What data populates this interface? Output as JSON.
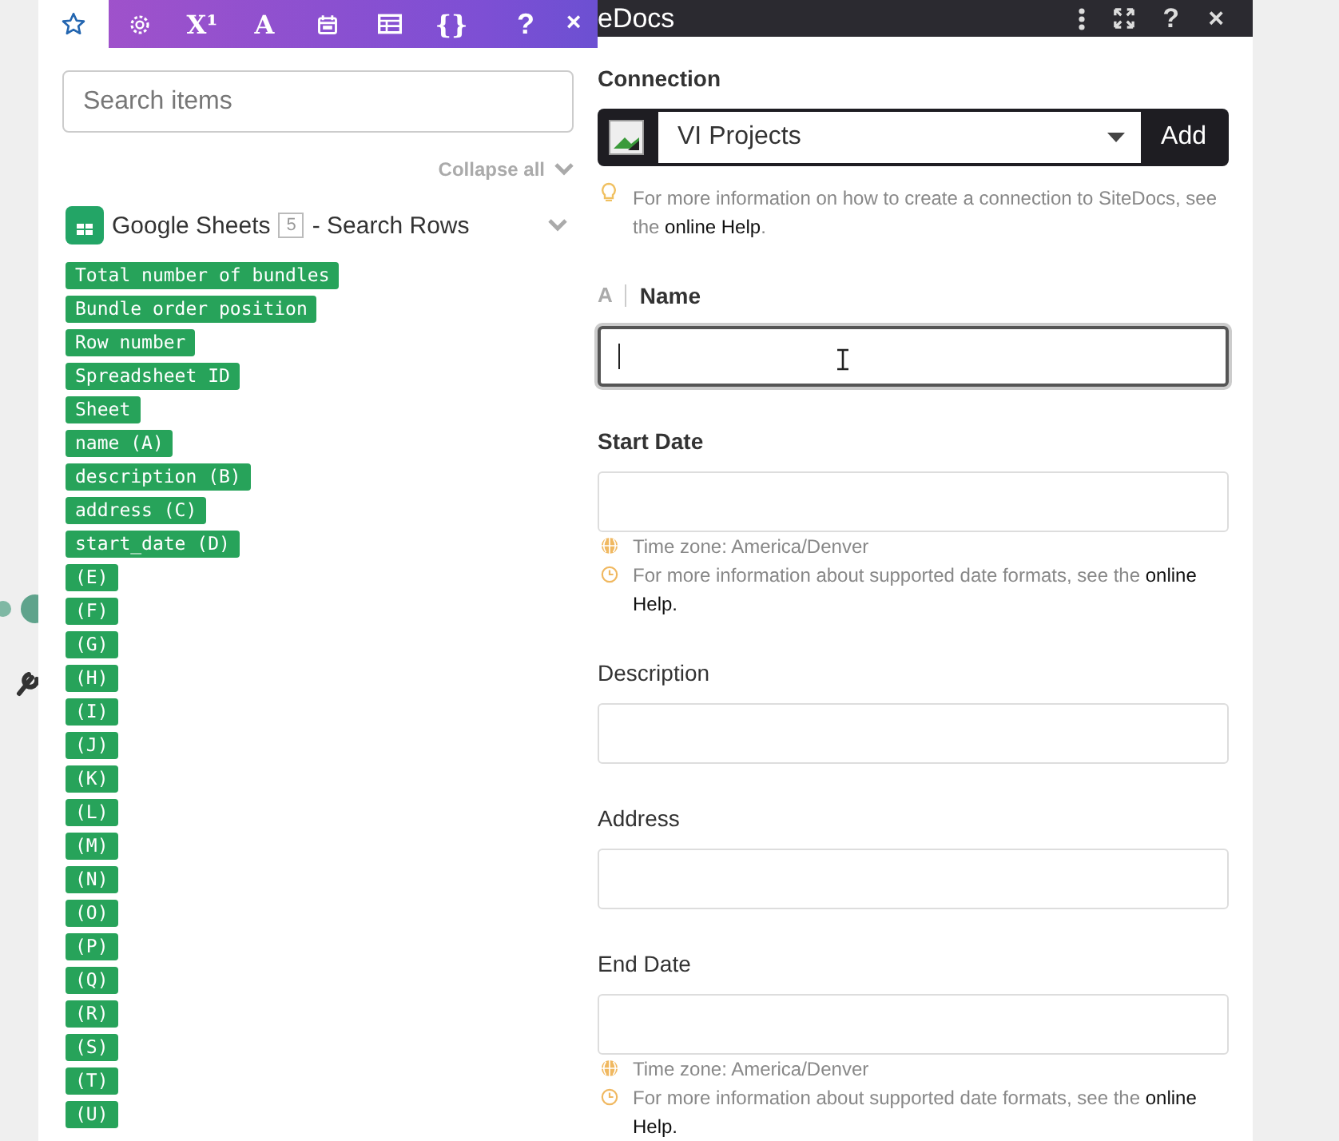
{
  "mapper": {
    "tabs": [
      {
        "kind": "star",
        "selected": true
      },
      {
        "kind": "gear",
        "selected": false
      },
      {
        "kind": "text",
        "label": "X¹",
        "selected": false
      },
      {
        "kind": "text",
        "label": "A",
        "selected": false
      },
      {
        "kind": "calendar",
        "selected": false
      },
      {
        "kind": "table",
        "selected": false
      },
      {
        "kind": "text",
        "label": "{}",
        "selected": false
      }
    ],
    "help": "?",
    "close": "×",
    "search": {
      "placeholder": "Search items"
    },
    "collapse_all": "Collapse all",
    "module": {
      "app": "Google Sheets",
      "number": "5",
      "action": "- Search Rows",
      "expanded": true
    },
    "items": [
      "Total number of bundles",
      "Bundle order position",
      "Row number",
      "Spreadsheet ID",
      "Sheet",
      "name (A)",
      "description (B)",
      "address (C)",
      "start_date (D)",
      "(E)",
      "(F)",
      "(G)",
      "(H)",
      "(I)",
      "(J)",
      "(K)",
      "(L)",
      "(M)",
      "(N)",
      "(O)",
      "(P)",
      "(Q)",
      "(R)",
      "(S)",
      "(T)",
      "(U)"
    ]
  },
  "dialog": {
    "title": "eDocs",
    "connection": {
      "label": "Connection",
      "value": "VI Projects",
      "add": "Add",
      "hint": {
        "text": "For more information on how to create a connection to SiteDocs, see the ",
        "link": "online Help",
        "after": "."
      }
    },
    "fields": [
      {
        "label": "Name",
        "required": true,
        "type_badge": "A",
        "focused": true
      },
      {
        "label": "Start Date",
        "required": true,
        "focused": false,
        "hints": [
          {
            "kind": "timezone",
            "text": "Time zone: America/Denver"
          },
          {
            "kind": "format",
            "text": "For more information about supported date formats, see the ",
            "link": "online",
            "after": "Help."
          }
        ]
      },
      {
        "label": "Description",
        "required": false,
        "focused": false
      },
      {
        "label": "Address",
        "required": false,
        "focused": false
      },
      {
        "label": "End Date",
        "required": false,
        "focused": false,
        "hints": [
          {
            "kind": "timezone",
            "text": "Time zone: America/Denver"
          },
          {
            "kind": "format",
            "text": "For more information about supported date formats, see the ",
            "link": "online",
            "after": "Help."
          }
        ]
      }
    ]
  }
}
